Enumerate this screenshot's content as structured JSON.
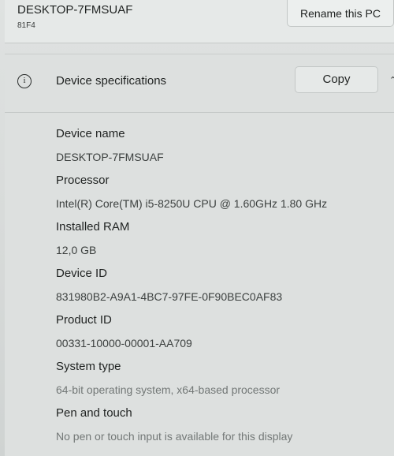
{
  "header": {
    "device_title": "DESKTOP-7FMSUAF",
    "model_code": "81F4",
    "rename_label": "Rename this PC"
  },
  "specs": {
    "icon": "info-icon",
    "section_title": "Device specifications",
    "copy_label": "Copy",
    "collapse_icon": "chevron-up-icon",
    "rows": [
      {
        "label": "Device name",
        "value": "DESKTOP-7FMSUAF"
      },
      {
        "label": "Processor",
        "value": "Intel(R) Core(TM) i5-8250U CPU @ 1.60GHz   1.80 GHz"
      },
      {
        "label": "Installed RAM",
        "value": "12,0 GB"
      },
      {
        "label": "Device ID",
        "value": "831980B2-A9A1-4BC7-97FE-0F90BEC0AF83"
      },
      {
        "label": "Product ID",
        "value": "00331-10000-00001-AA709"
      },
      {
        "label": "System type",
        "value": "64-bit operating system, x64-based processor"
      },
      {
        "label": "Pen and touch",
        "value": "No pen or touch input is available for this display"
      }
    ]
  }
}
